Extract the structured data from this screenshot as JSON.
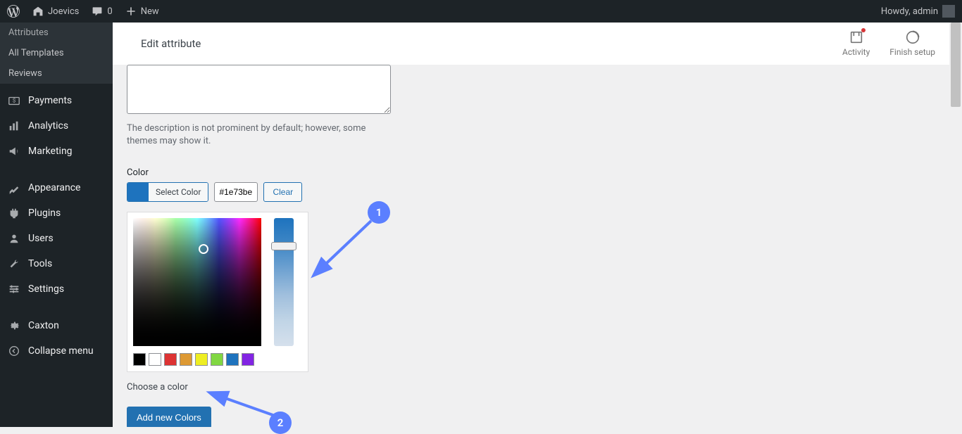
{
  "adminbar": {
    "site_name": "Joevics",
    "comments_count": "0",
    "new_label": "New",
    "howdy": "Howdy, admin"
  },
  "sidebar": {
    "attributes": "Attributes",
    "all_templates": "All Templates",
    "reviews": "Reviews",
    "payments": "Payments",
    "analytics": "Analytics",
    "marketing": "Marketing",
    "appearance": "Appearance",
    "plugins": "Plugins",
    "users": "Users",
    "tools": "Tools",
    "settings": "Settings",
    "caxton": "Caxton",
    "collapse": "Collapse menu"
  },
  "header": {
    "title": "Edit attribute",
    "activity": "Activity",
    "finish_setup": "Finish setup"
  },
  "form": {
    "description_help": "The description is not prominent by default; however, some themes may show it.",
    "color_label": "Color",
    "select_color": "Select Color",
    "hex_value": "#1e73be",
    "clear": "Clear",
    "choose_label": "Choose a color",
    "add_button": "Add new Colors"
  },
  "palette": [
    "#000000",
    "#ffffff",
    "#dd3333",
    "#dd9933",
    "#eeee22",
    "#81d742",
    "#1e73be",
    "#8224e3"
  ],
  "annotations": {
    "num1": "1",
    "num2": "2"
  }
}
